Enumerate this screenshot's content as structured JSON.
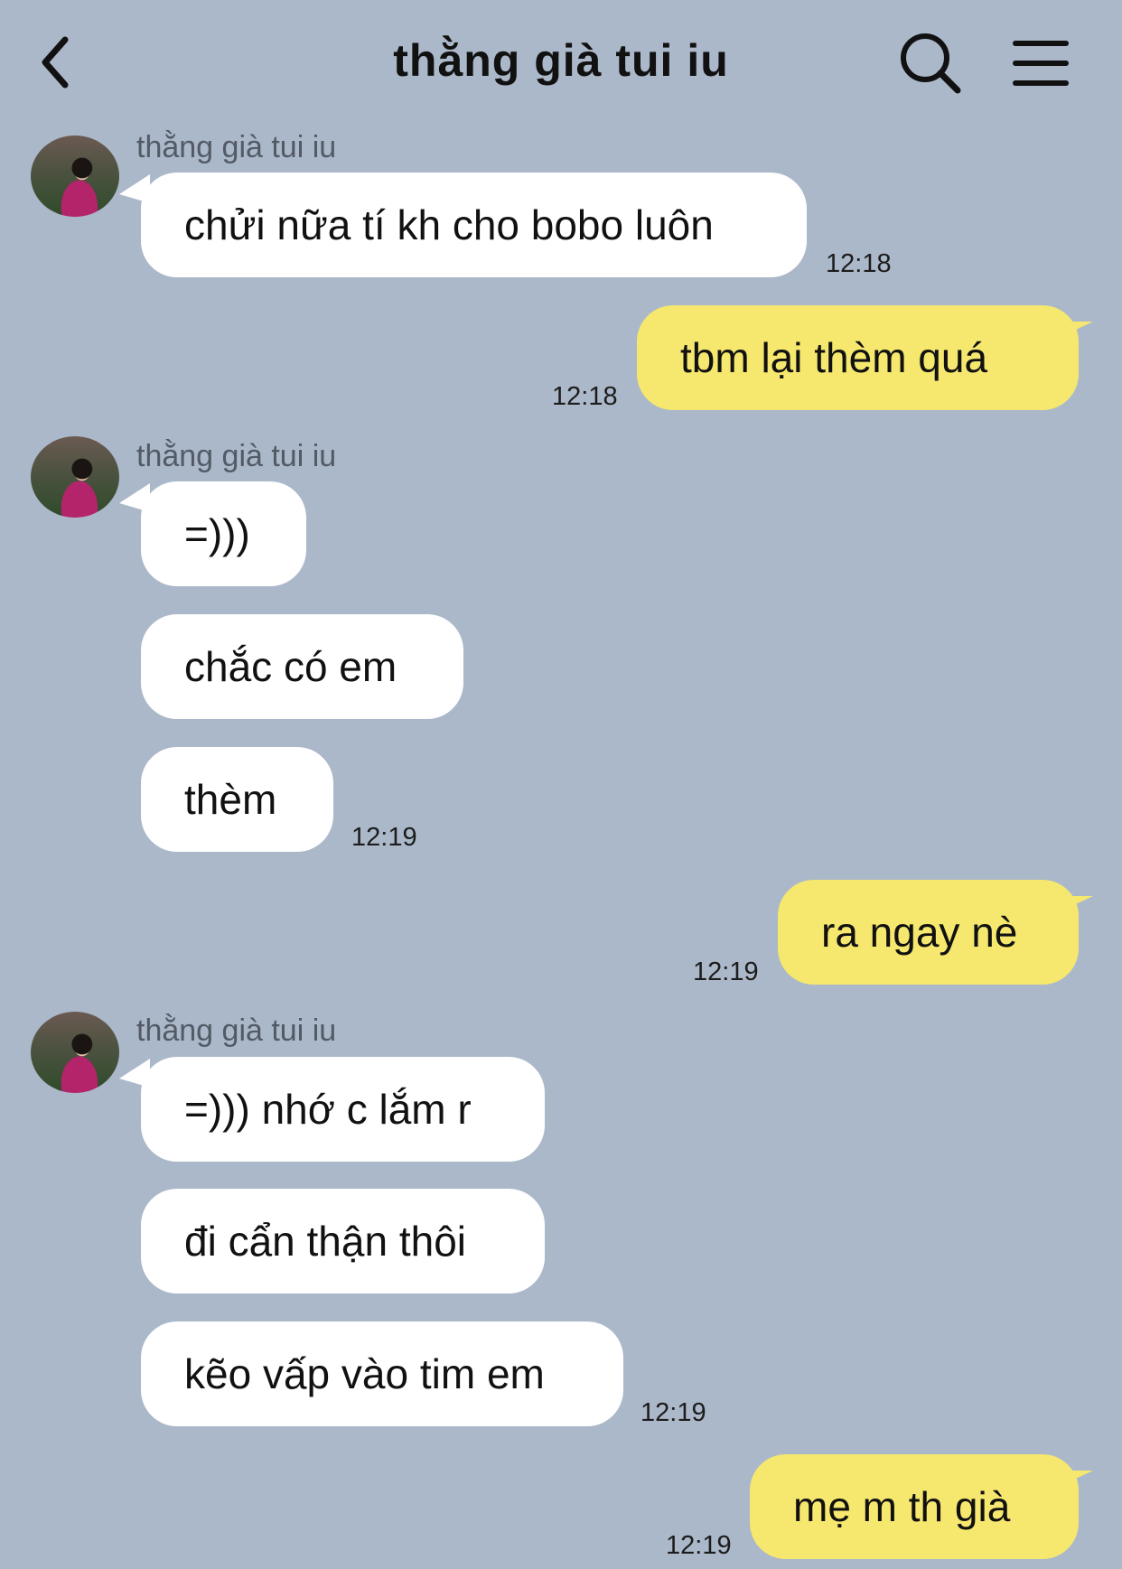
{
  "header": {
    "title": "thằng già tui iu",
    "back_icon": "chevron-left-icon",
    "search_icon": "search-icon",
    "menu_icon": "hamburger-menu-icon"
  },
  "contact": {
    "name": "thằng già tui iu"
  },
  "messages": [
    {
      "dir": "in",
      "text": "chửi nữa tí kh cho bobo luôn",
      "time": "12:18"
    },
    {
      "dir": "out",
      "text": "tbm lại thèm quá",
      "time": "12:18"
    },
    {
      "dir": "in",
      "text": "=)))",
      "time": ""
    },
    {
      "dir": "in",
      "text": "chắc có em",
      "time": ""
    },
    {
      "dir": "in",
      "text": "thèm",
      "time": "12:19"
    },
    {
      "dir": "out",
      "text": "ra ngay nè",
      "time": "12:19"
    },
    {
      "dir": "in",
      "text": "=))) nhớ c lắm r",
      "time": ""
    },
    {
      "dir": "in",
      "text": "đi cẩn thận thôi",
      "time": ""
    },
    {
      "dir": "in",
      "text": "kẽo vấp vào tim em",
      "time": "12:19"
    },
    {
      "dir": "out",
      "text": "mẹ m th già",
      "time": "12:19"
    }
  ],
  "colors": {
    "background": "#abb8c9",
    "incoming_bubble": "#ffffff",
    "outgoing_bubble": "#f6e86e"
  }
}
